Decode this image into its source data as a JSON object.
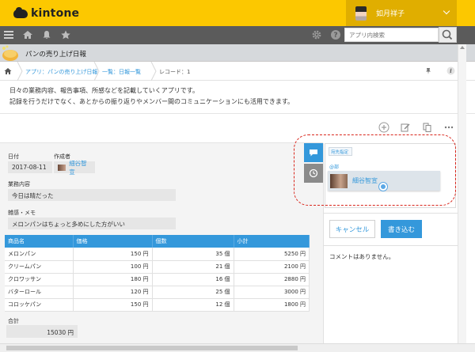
{
  "header": {
    "brand": "kintone",
    "user_name": "如月祥子",
    "search_placeholder": "アプリ内検索"
  },
  "app": {
    "title": "パンの売り上げ日報"
  },
  "breadcrumb": {
    "app": "アプリ：パンの売り上げ日報",
    "list": "一覧：日報一覧",
    "record": "レコード：1"
  },
  "description": {
    "line1": "日々の業務内容、報告事項、所感などを記載していくアプリです。",
    "line2": "記録を行うだけでなく、あとからの振り返りやメンバー間のコミュニケーションにも活用できます。"
  },
  "record": {
    "date_label": "日付",
    "date_value": "2017-08-11",
    "creator_label": "作成者",
    "creator_value": "細谷智宣",
    "work_label": "業務内容",
    "work_value": "今日は晴だった",
    "memo_label": "雑感・メモ",
    "memo_value": "メロンパンはちょっと多めにした方がいい",
    "total_label": "合計",
    "total_value": "15030 円"
  },
  "table": {
    "headers": [
      "商品名",
      "価格",
      "個数",
      "小計"
    ],
    "rows": [
      [
        "メロンパン",
        "150 円",
        "35 個",
        "5250 円"
      ],
      [
        "クリームパン",
        "100 円",
        "21 個",
        "2100 円"
      ],
      [
        "クロワッサン",
        "180 円",
        "16 個",
        "2880 円"
      ],
      [
        "バターロール",
        "120 円",
        "25 個",
        "3000 円"
      ],
      [
        "コロッケパン",
        "150 円",
        "12 個",
        "1800 円"
      ]
    ]
  },
  "comment": {
    "recipient_tag": "宛先指定",
    "mention_label": "@部",
    "mention_name": "細谷智宣",
    "cancel_label": "キャンセル",
    "write_label": "書き込む",
    "empty_text": "コメントはありません。"
  },
  "colors": {
    "brand_yellow": "#fcc800",
    "accent_blue": "#3498db",
    "highlight_red": "#d9261c"
  }
}
